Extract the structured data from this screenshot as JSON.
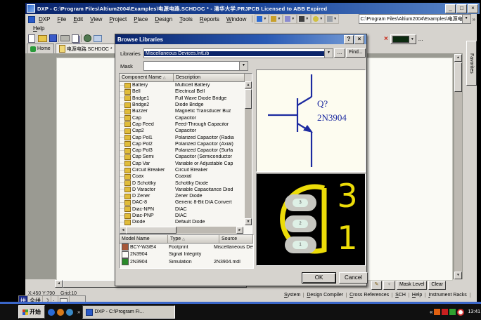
{
  "colors": {
    "titlebar": "#0a246a",
    "window_face": "#d6d3ce",
    "selection": "#0a246a",
    "schematic_symbol": "#1c2aa0",
    "footprint_silk": "#ecdc08",
    "footprint_bg": "#000000",
    "taskbar_line": "#3a66c8"
  },
  "window": {
    "title": "DXP - C:\\Program Files\\Altium2004\\Examples\\电源电路.SCHDOC * - 清华大学.PRJPCB  Licensed to ABB Expired",
    "menu_items": [
      "DXP",
      "File",
      "Edit",
      "View",
      "Project",
      "Place",
      "Design",
      "Tools",
      "Reports",
      "Window"
    ],
    "help_menu": "Help",
    "address_value": "C:\\Program Files\\Altium2004\\Examples\\电源电...",
    "overflow_chevron": "»",
    "toolbar_more": "...",
    "home_tab": "Home",
    "document_tab": "电源电路.SCHDOC *",
    "favorites_tab": "Favorites"
  },
  "dialog": {
    "title": "Browse Libraries",
    "help_button": "?",
    "close_button": "×",
    "libraries_label": "Libraries",
    "libraries_value": "Miscellaneous Devices.IntLib",
    "more_button": "...",
    "find_button": "Find...",
    "mask_label": "Mask",
    "component_columns": [
      "Component Name",
      "Description"
    ],
    "sort_glyph": "△",
    "components": [
      {
        "name": "Battery",
        "desc": "Multicell Battery"
      },
      {
        "name": "Bell",
        "desc": "Electrical Bell"
      },
      {
        "name": "Bridge1",
        "desc": "Full Wave Diode Bridge"
      },
      {
        "name": "Bridge2",
        "desc": "Diode Bridge"
      },
      {
        "name": "Buzzer",
        "desc": "Magnetic Transducer Buz"
      },
      {
        "name": "Cap",
        "desc": "Capacitor"
      },
      {
        "name": "Cap Feed",
        "desc": "Feed-Through Capacitor"
      },
      {
        "name": "Cap2",
        "desc": "Capacitor"
      },
      {
        "name": "Cap Pol1",
        "desc": "Polarized Capacitor (Radia"
      },
      {
        "name": "Cap Pol2",
        "desc": "Polarized Capacitor (Axial)"
      },
      {
        "name": "Cap Pol3",
        "desc": "Polarized Capacitor (Surfa"
      },
      {
        "name": "Cap Semi",
        "desc": "Capacitor (Semiconductor"
      },
      {
        "name": "Cap Var",
        "desc": "Variable or Adjustable Cap"
      },
      {
        "name": "Circuit Breaker",
        "desc": "Circuit Breaker"
      },
      {
        "name": "Coax",
        "desc": "Coaxial"
      },
      {
        "name": "D Schottky",
        "desc": "Schottky Diode"
      },
      {
        "name": "D Varactor",
        "desc": "Variable Capacitance Diod"
      },
      {
        "name": "D Zener",
        "desc": "Zener Diode"
      },
      {
        "name": "DAC-8",
        "desc": "Generic 8-Bit D/A Convert"
      },
      {
        "name": "Diac-NPN",
        "desc": "DIAC"
      },
      {
        "name": "Diac-PNP",
        "desc": "DIAC"
      },
      {
        "name": "Diode",
        "desc": "Default Diode"
      }
    ],
    "model_columns": [
      "Model Name",
      "Type",
      "Source"
    ],
    "models": [
      {
        "name": "BCY-W3/E4",
        "type": "Footprint",
        "source": "Miscellaneous Devic",
        "icon": "footprint"
      },
      {
        "name": "2N3904",
        "type": "Signal Integrity",
        "source": "",
        "icon": "signal"
      },
      {
        "name": "2N3904",
        "type": "Simulation",
        "source": "2N3904.mdl",
        "icon": "simulation"
      }
    ],
    "ok_button": "OK",
    "cancel_button": "Cancel",
    "symbol_preview": {
      "designator": "Q?",
      "value": "2N3904"
    },
    "footprint_preview": {
      "pad_labels": [
        "3",
        "2",
        "1"
      ],
      "corner_labels": [
        "3",
        "1"
      ]
    }
  },
  "status": {
    "coords": "X:450 Y:790",
    "grid": "Grid:10",
    "mask_level_button": "Mask Level",
    "clear_button": "Clear",
    "panels": [
      "System",
      "Design Compiler",
      "Cross References",
      "SCH",
      "Help",
      "Instrument Racks"
    ]
  },
  "ime": {
    "indicator": "拼",
    "mode": "全拼",
    "moon": "☽"
  },
  "taskbar": {
    "start": "开始",
    "quick_launch_chevron": "»",
    "running_app": "DXP - C:\\Program Fi...",
    "tray_chevron": "«",
    "clock": "13:41"
  }
}
